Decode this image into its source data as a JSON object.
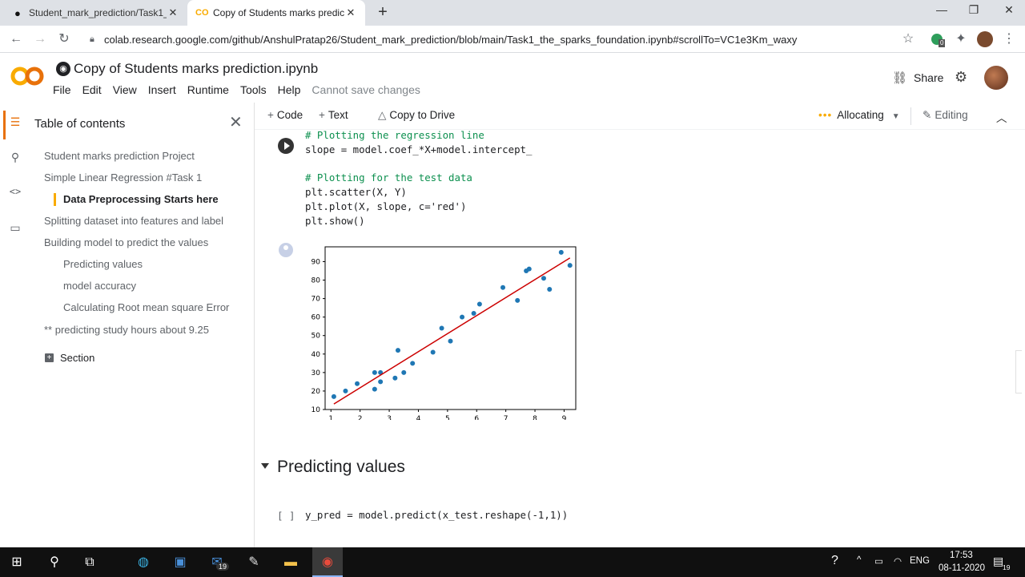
{
  "browser": {
    "tabs": [
      {
        "title": "Student_mark_prediction/Task1_t",
        "icon": "github-icon"
      },
      {
        "title": "Copy of Students marks predicti",
        "icon": "colab-icon"
      }
    ],
    "url": "colab.research.google.com/github/AnshulPratap26/Student_mark_prediction/blob/main/Task1_the_sparks_foundation.ipynb#scrollTo=VC1e3Km_waxy",
    "extension_badge": "0"
  },
  "colab": {
    "logo_text": "CO",
    "title": "Copy of Students marks prediction.ipynb",
    "menu": [
      "File",
      "Edit",
      "View",
      "Insert",
      "Runtime",
      "Tools",
      "Help"
    ],
    "save_status": "Cannot save changes",
    "share_label": "Share"
  },
  "toc": {
    "title": "Table of contents",
    "items": [
      {
        "label": "Student marks prediction Project",
        "level": 1
      },
      {
        "label": "Simple Linear Regression #Task 1",
        "level": 1
      },
      {
        "label": "Data Preprocessing Starts here",
        "level": 2,
        "active": true
      },
      {
        "label": "Splitting dataset into features and label",
        "level": 1
      },
      {
        "label": "Building model to predict the values",
        "level": 1
      },
      {
        "label": "Predicting values",
        "level": 2
      },
      {
        "label": "model accuracy",
        "level": 2
      },
      {
        "label": "Calculating Root mean square Error",
        "level": 2
      },
      {
        "label": "** predicting study hours about 9.25",
        "level": 1
      }
    ],
    "section_label": "Section"
  },
  "toolbar": {
    "code_label": "Code",
    "text_label": "Text",
    "copy_label": "Copy to Drive",
    "allocating_label": "Allocating",
    "editing_label": "Editing"
  },
  "cell1": {
    "lines": [
      "# Plotting the regression line",
      "slope = model.coef_*X+model.intercept_",
      "",
      "# Plotting for the test data",
      "plt.scatter(X, Y)",
      "plt.plot(X, slope, c='red')",
      "plt.show()"
    ]
  },
  "chart_data": {
    "type": "scatter",
    "xlim": [
      0.8,
      9.4
    ],
    "ylim": [
      10,
      98
    ],
    "xticks": [
      1,
      2,
      3,
      4,
      5,
      6,
      7,
      8,
      9
    ],
    "yticks": [
      10,
      20,
      30,
      40,
      50,
      60,
      70,
      80,
      90
    ],
    "series": [
      {
        "kind": "scatter",
        "color": "#1f77b4",
        "x": [
          1.1,
          1.5,
          1.9,
          2.5,
          2.5,
          2.7,
          2.7,
          3.2,
          3.3,
          3.5,
          3.8,
          4.5,
          4.8,
          5.1,
          5.5,
          5.9,
          6.1,
          6.9,
          7.4,
          7.7,
          7.8,
          8.3,
          8.5,
          8.9,
          9.2
        ],
        "y": [
          17,
          20,
          24,
          21,
          30,
          25,
          30,
          27,
          42,
          30,
          35,
          41,
          54,
          47,
          60,
          62,
          67,
          76,
          69,
          85,
          86,
          81,
          75,
          95,
          88
        ]
      },
      {
        "kind": "line",
        "color": "#cc0000",
        "x": [
          1.1,
          9.2
        ],
        "y": [
          13,
          92
        ]
      }
    ]
  },
  "heading": {
    "text": "Predicting values"
  },
  "cell2": {
    "bracket": "[ ]",
    "code": "y_pred = model.predict(x_test.reshape(-1,1))"
  },
  "taskbar": {
    "language": "ENG",
    "time": "17:53",
    "date": "08-11-2020",
    "notification_count": "19",
    "mail_count": "19"
  }
}
